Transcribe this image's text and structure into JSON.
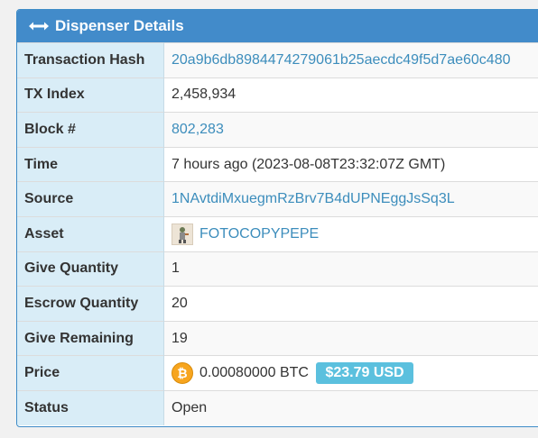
{
  "panel": {
    "title": "Dispenser Details",
    "icon": "arrows-horizontal-icon",
    "header_color": "#428bca"
  },
  "rows": {
    "tx_hash": {
      "label": "Transaction Hash",
      "value": "20a9b6db8984474279061b25aecdc49f5d7ae60c480"
    },
    "tx_index": {
      "label": "TX Index",
      "value": "2,458,934"
    },
    "block": {
      "label": "Block #",
      "value": "802,283"
    },
    "time": {
      "label": "Time",
      "value": "7 hours ago (2023-08-08T23:32:07Z GMT)"
    },
    "source": {
      "label": "Source",
      "value": "1NAvtdiMxuegmRzBrv7B4dUPNEggJsSq3L"
    },
    "asset": {
      "label": "Asset",
      "value": "FOTOCOPYPEPE",
      "icon": "asset-thumbnail-icon"
    },
    "give_quantity": {
      "label": "Give Quantity",
      "value": "1"
    },
    "escrow_quantity": {
      "label": "Escrow Quantity",
      "value": "20"
    },
    "give_remaining": {
      "label": "Give Remaining",
      "value": "19"
    },
    "price": {
      "label": "Price",
      "value": "0.00080000 BTC",
      "usd": "$23.79 USD",
      "icon": "bitcoin-icon",
      "badge_color": "#5bc0de"
    },
    "status": {
      "label": "Status",
      "value": "Open"
    }
  }
}
